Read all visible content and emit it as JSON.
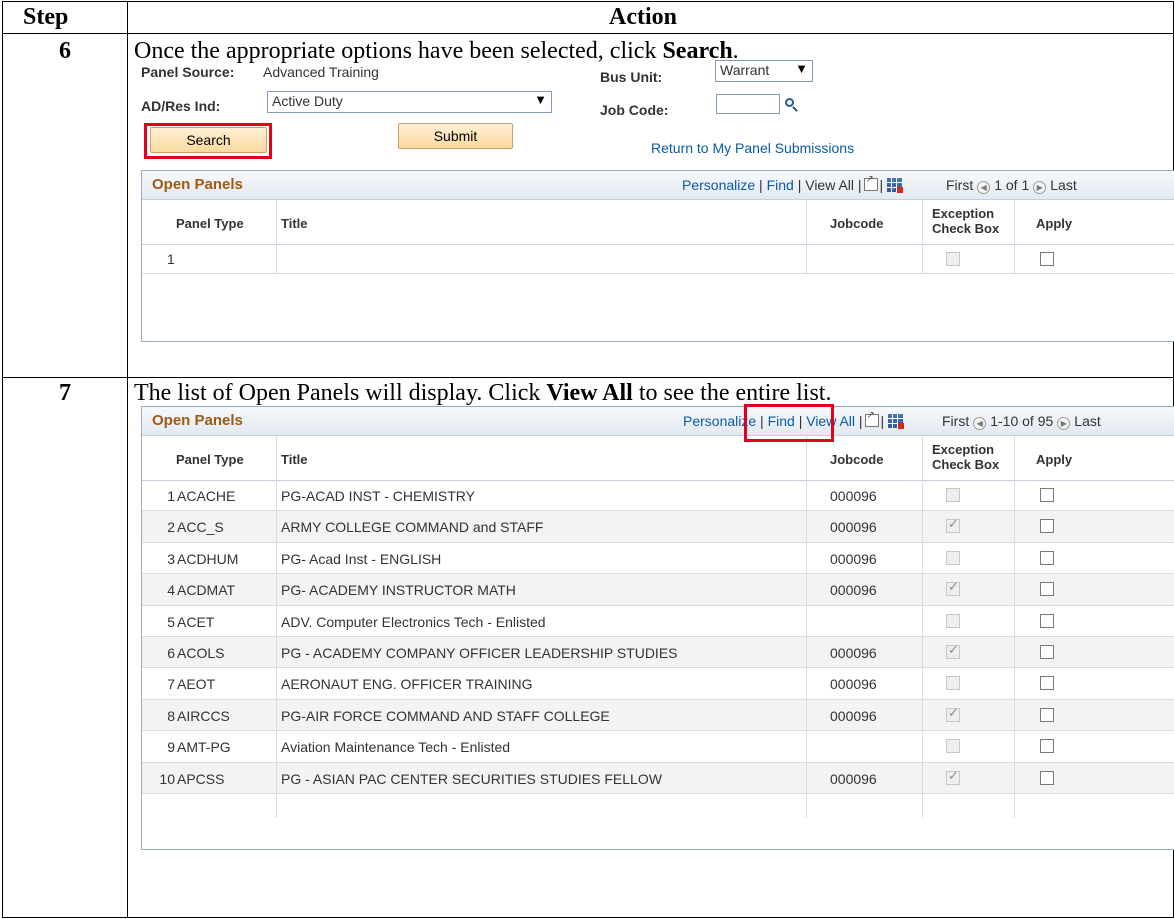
{
  "header": {
    "step": "Step",
    "action": "Action"
  },
  "step6": {
    "number": "6",
    "text_before": "Once the appropriate options have been selected, click ",
    "text_bold": "Search",
    "text_after": ".",
    "form": {
      "panel_source_label": "Panel Source:",
      "panel_source_value": "Advanced Training",
      "bus_unit_label": "Bus Unit:",
      "bus_unit_value": "Warrant",
      "ad_res_label": "AD/Res Ind:",
      "ad_res_value": "Active Duty",
      "job_code_label": "Job Code:",
      "job_code_value": "",
      "search_button": "Search",
      "submit_button": "Submit",
      "return_link": "Return to My Panel Submissions"
    },
    "grid": {
      "title": "Open Panels",
      "personalize": "Personalize",
      "find": "Find",
      "view_all": "View All",
      "first": "First",
      "range": "1 of 1",
      "last": "Last",
      "columns": [
        "Panel Type",
        "Title",
        "Jobcode",
        "Exception Check Box",
        "Apply"
      ],
      "exception_line1": "Exception",
      "exception_line2": "Check Box",
      "rows": [
        {
          "num": "1",
          "type": "",
          "title": "",
          "jobcode": "",
          "exception": false,
          "apply": false
        }
      ]
    }
  },
  "step7": {
    "number": "7",
    "text_before": "The list of Open Panels will display. Click ",
    "text_bold": "View All",
    "text_after": " to see the entire list.",
    "grid": {
      "title": "Open Panels",
      "personalize": "Personalize",
      "find": "Find",
      "view_all": "View All",
      "first": "First",
      "range": "1-10 of 95",
      "last": "Last",
      "col_panel_type": "Panel Type",
      "col_title": "Title",
      "col_jobcode": "Jobcode",
      "exception_line1": "Exception",
      "exception_line2": "Check Box",
      "col_apply": "Apply",
      "rows": [
        {
          "num": "1",
          "type": "ACACHE",
          "title": "PG-ACAD INST - CHEMISTRY",
          "jobcode": "000096",
          "exception": false
        },
        {
          "num": "2",
          "type": "ACC_S",
          "title": "ARMY COLLEGE COMMAND and STAFF",
          "jobcode": "000096",
          "exception": true
        },
        {
          "num": "3",
          "type": "ACDHUM",
          "title": "PG- Acad Inst - ENGLISH",
          "jobcode": "000096",
          "exception": false
        },
        {
          "num": "4",
          "type": "ACDMAT",
          "title": "PG- ACADEMY INSTRUCTOR MATH",
          "jobcode": "000096",
          "exception": true
        },
        {
          "num": "5",
          "type": "ACET",
          "title": "ADV. Computer Electronics Tech - Enlisted",
          "jobcode": "",
          "exception": false
        },
        {
          "num": "6",
          "type": "ACOLS",
          "title": "PG - ACADEMY COMPANY OFFICER LEADERSHIP STUDIES",
          "jobcode": "000096",
          "exception": true
        },
        {
          "num": "7",
          "type": "AEOT",
          "title": "AERONAUT ENG. OFFICER TRAINING",
          "jobcode": "000096",
          "exception": false
        },
        {
          "num": "8",
          "type": "AIRCCS",
          "title": "PG-AIR FORCE COMMAND AND STAFF COLLEGE",
          "jobcode": "000096",
          "exception": true
        },
        {
          "num": "9",
          "type": "AMT-PG",
          "title": "Aviation Maintenance Tech - Enlisted",
          "jobcode": "",
          "exception": false
        },
        {
          "num": "10",
          "type": "APCSS",
          "title": "PG - ASIAN PAC CENTER SECURITIES STUDIES FELLOW",
          "jobcode": "000096",
          "exception": true
        }
      ]
    }
  }
}
